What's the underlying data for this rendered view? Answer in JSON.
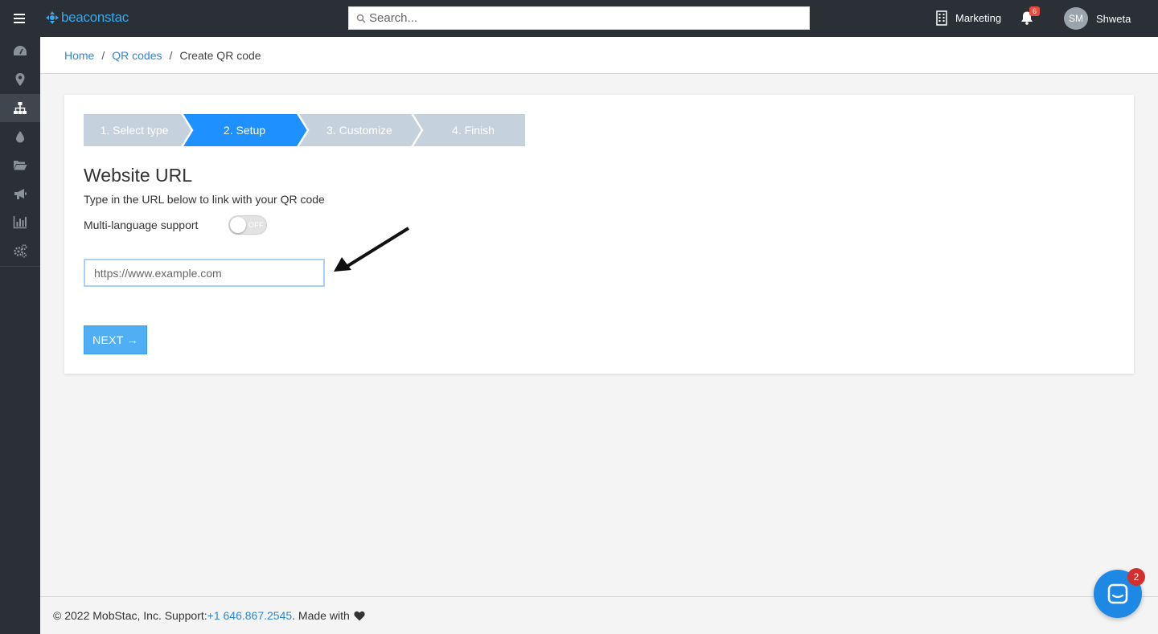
{
  "header": {
    "logo_text": "beaconstac",
    "search_placeholder": "Search...",
    "org_name": "Marketing",
    "notification_count": "6",
    "avatar_initials": "SM",
    "username": "Shweta"
  },
  "sidebar": {
    "items": [
      {
        "icon": "dashboard-icon"
      },
      {
        "icon": "location-pin-icon"
      },
      {
        "icon": "sitemap-icon",
        "active": true
      },
      {
        "icon": "drop-icon"
      },
      {
        "icon": "folder-icon"
      },
      {
        "icon": "megaphone-icon"
      },
      {
        "icon": "analytics-icon"
      },
      {
        "icon": "settings-icon"
      }
    ]
  },
  "breadcrumb": {
    "home": "Home",
    "sep1": "/",
    "qr_codes": "QR codes",
    "sep2": "/",
    "current": "Create QR code"
  },
  "wizard": {
    "steps": [
      "1. Select type",
      "2. Setup",
      "3. Customize",
      "4. Finish"
    ],
    "active_step": 2
  },
  "form": {
    "title": "Website URL",
    "subtitle": "Type in the URL below to link with your QR code",
    "multilang_label": "Multi-language support",
    "toggle_state": "OFF",
    "url_placeholder": "https://www.example.com",
    "url_value": "",
    "next_label": "NEXT →"
  },
  "footer": {
    "copyright": "© 2022 MobStac, Inc. Support: ",
    "phone": "+1 646.867.2545",
    "made_with": ". Made with"
  },
  "chat": {
    "badge": "2"
  },
  "colors": {
    "topbar": "#2b3036",
    "accent": "#1e90ff",
    "step_inactive": "#c5d1dc",
    "link": "#2f86d6",
    "button": "#50aef5"
  }
}
